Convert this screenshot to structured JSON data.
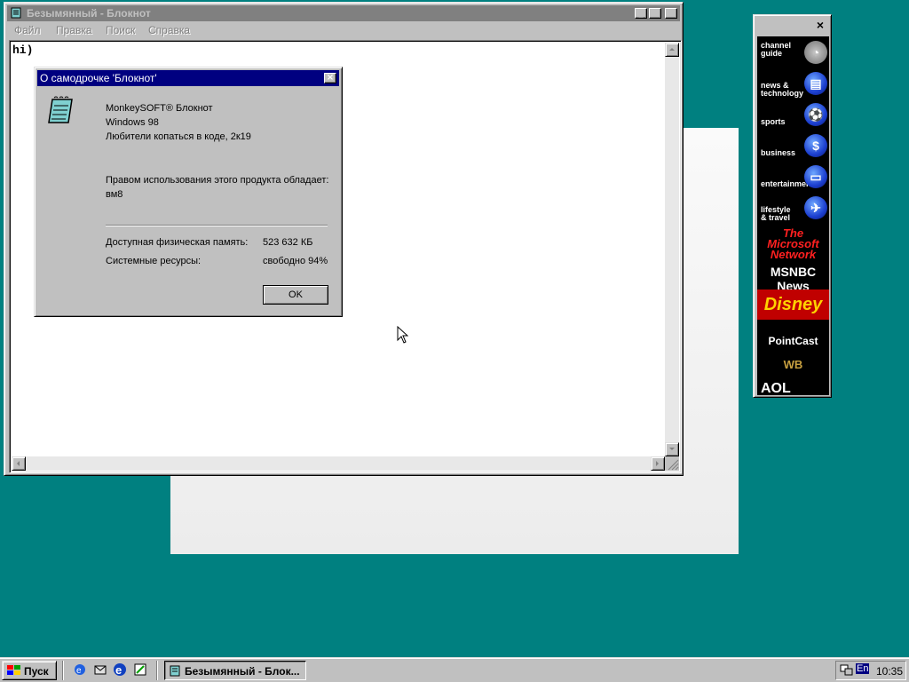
{
  "notepad": {
    "title": "Безымянный - Блокнот",
    "menu": [
      "Файл",
      "Правка",
      "Поиск",
      "Справка"
    ],
    "text": "hi)"
  },
  "about": {
    "title": "О самодрочке 'Блокнот'",
    "product": "MonkeySOFT® Блокнот",
    "os": "Windows 98",
    "tagline": "Любители копаться в коде, 2к19",
    "license_label": "Правом использования этого продукта обладает:",
    "owner": "вм8",
    "memory_label": "Доступная физическая память:",
    "memory_value": "523 632 КБ",
    "resources_label": "Системные ресурсы:",
    "resources_value": "свободно 94%",
    "ok_label": "OK"
  },
  "channel_bar": {
    "channels": [
      {
        "label1": "channel",
        "label2": "guide",
        "icon": "channel-guide-icon"
      },
      {
        "label1": "news &",
        "label2": "technology",
        "icon": "news-icon"
      },
      {
        "label1": "",
        "label2": "sports",
        "icon": "sports-icon"
      },
      {
        "label1": "",
        "label2": "business",
        "icon": "business-icon"
      },
      {
        "label1": "",
        "label2": "entertainment",
        "icon": "entertainment-icon"
      },
      {
        "label1": "lifestyle",
        "label2": "& travel",
        "icon": "travel-icon"
      }
    ],
    "brands": [
      "The Microsoft Network",
      "MSNBC News",
      "Disney",
      "PointCast",
      "WB",
      "AOL"
    ],
    "close_symbol": "×"
  },
  "taskbar": {
    "start_label": "Пуск",
    "task_label": "Безымянный - Блок...",
    "lang": "En",
    "clock": "10:35"
  }
}
